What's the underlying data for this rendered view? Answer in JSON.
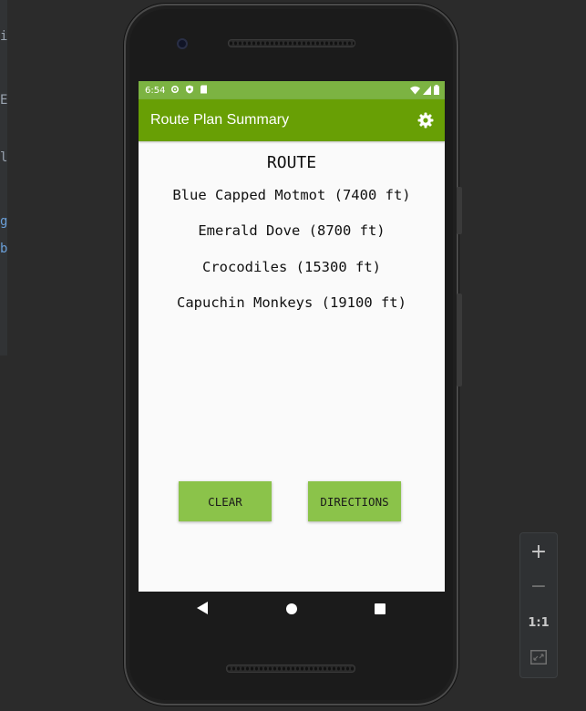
{
  "ide_edge_glyphs": [
    "i",
    "E",
    "l",
    "g",
    "b"
  ],
  "status_bar": {
    "time": "6:54",
    "left_icons": [
      "settings-status-icon",
      "shield-status-icon",
      "sd-card-status-icon"
    ],
    "right_icons": [
      "wifi-icon",
      "cell-signal-icon",
      "battery-icon"
    ]
  },
  "app_bar": {
    "title": "Route Plan Summary",
    "action_icon": "gear-icon"
  },
  "main": {
    "heading": "ROUTE",
    "route_items": [
      "Blue Capped Motmot (7400 ft)",
      "Emerald Dove (8700 ft)",
      "Crocodiles (15300 ft)",
      "Capuchin Monkeys (19100 ft)"
    ],
    "buttons": {
      "clear_label": "CLEAR",
      "directions_label": "DIRECTIONS"
    }
  },
  "nav_bar": [
    "back-icon",
    "home-icon",
    "recents-icon"
  ],
  "emulator_zoom_controls": {
    "zoom_in": "+",
    "zoom_out": "−",
    "actual_size": "1:1",
    "fit_screen_icon": "fit-screen-icon"
  },
  "colors": {
    "status_bar": "#7cb342",
    "app_bar": "#689f05",
    "button": "#8bc34a",
    "screen_background": "#fafafa"
  }
}
